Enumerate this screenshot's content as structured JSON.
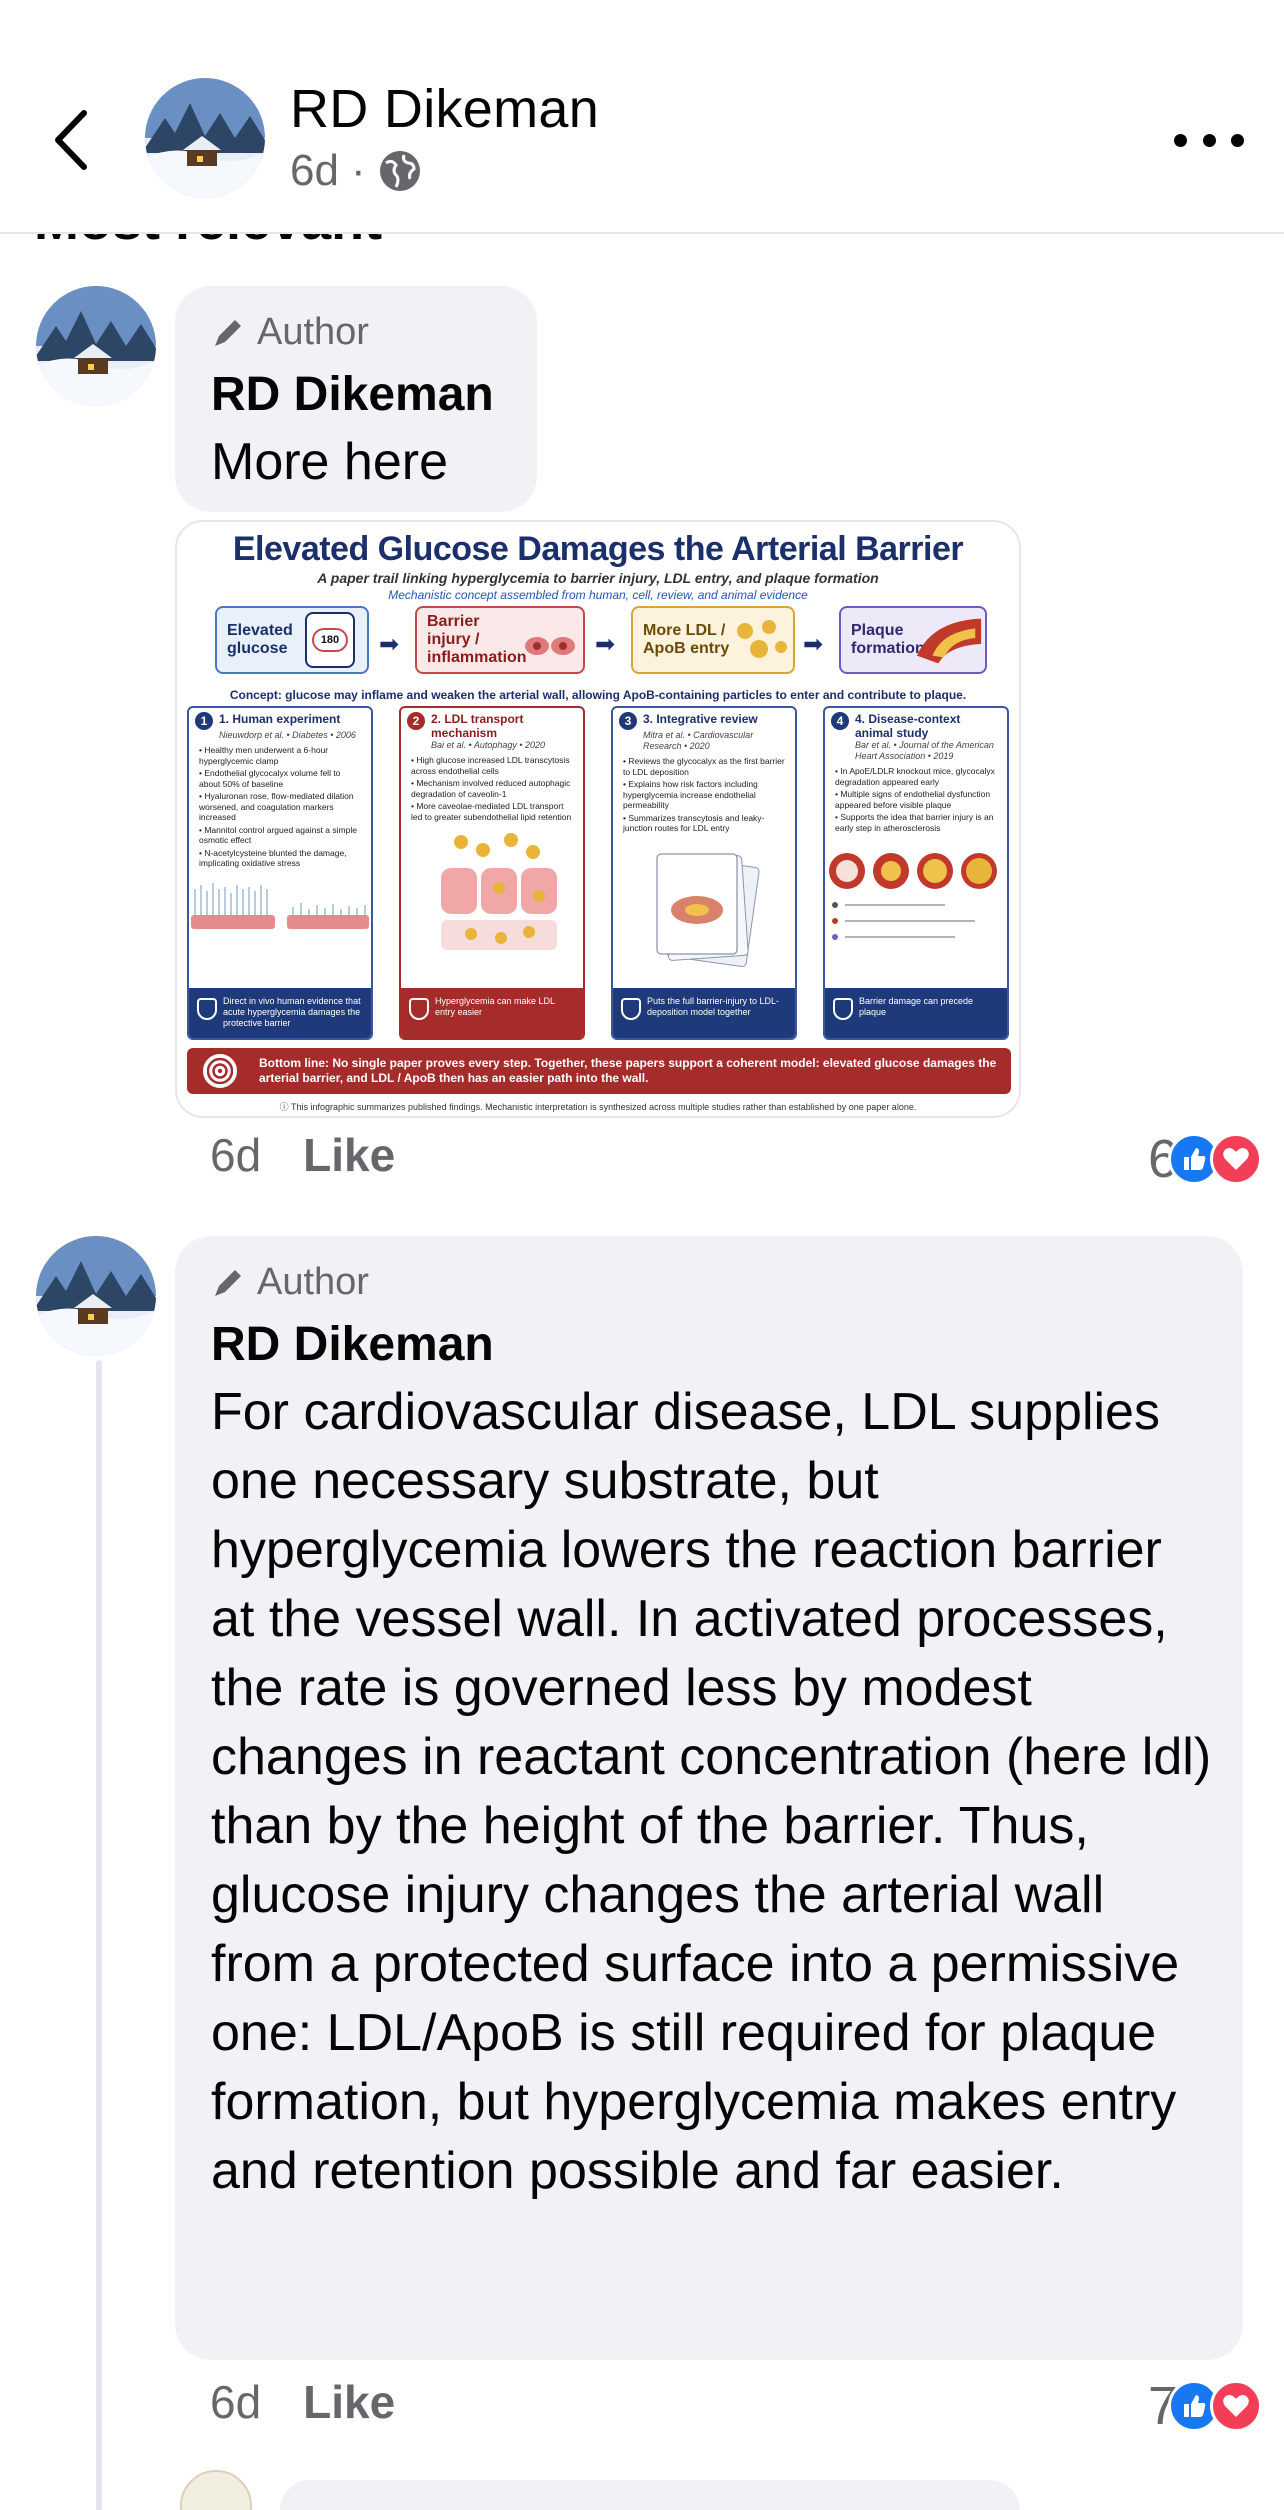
{
  "header": {
    "author_name": "RD Dikeman",
    "age": "6d",
    "separator": "·",
    "audience_icon": "globe-icon",
    "back_icon": "chevron-left-icon",
    "more_icon": "more-horizontal-icon"
  },
  "sort_label": "Most relevant",
  "comments": [
    {
      "badge": "Author",
      "name": "RD Dikeman",
      "text": "More here",
      "age": "6d",
      "like_label": "Like",
      "reaction_count": "6",
      "reactions": [
        "like-reaction-icon",
        "love-reaction-icon"
      ]
    },
    {
      "badge": "Author",
      "name": "RD Dikeman",
      "text": "For cardiovascular disease, LDL supplies one necessary substrate, but hyperglycemia  lowers the reaction barrier at the vessel wall. In activated processes, the rate is governed less by modest changes in reactant concentration (here ldl) than by the height of the barrier. Thus, glucose injury changes the arterial wall from a protected surface into a permissive one: LDL/ApoB is still required for plaque formation, but hyperglycemia makes entry and retention possible and far easier.",
      "age": "6d",
      "like_label": "Like",
      "reaction_count": "7",
      "reactions": [
        "like-reaction-icon",
        "love-reaction-icon"
      ]
    }
  ],
  "infographic": {
    "title": "Elevated Glucose Damages the Arterial Barrier",
    "subtitle": "A paper trail linking hyperglycemia to barrier injury, LDL entry, and plaque formation",
    "subtitle2": "Mechanistic concept assembled from human, cell, review, and animal evidence",
    "flow": [
      "Elevated glucose",
      "Barrier injury / inflammation",
      "More LDL / ApoB entry",
      "Plaque formation"
    ],
    "meter_value": "180",
    "concept": "Concept: glucose may inflame and weaken the arterial wall, allowing ApoB-containing particles to enter and contribute to plaque.",
    "panels": [
      {
        "num": "1",
        "title": "1. Human experiment",
        "cite": "Nieuwdorp et al. • Diabetes • 2006",
        "bullets": [
          "• Healthy men underwent a 6-hour hyperglycemic clamp",
          "• Endothelial glycocalyx volume fell to about 50% of baseline",
          "• Hyaluronan rose, flow-mediated dilation worsened, and coagulation markers increased",
          "• Mannitol control argued against a simple osmotic effect",
          "• N-acetylcysteine blunted the damage, implicating oxidative stress"
        ],
        "footer": "Direct in vivo human evidence that acute hyperglycemia damages the protective barrier"
      },
      {
        "num": "2",
        "title": "2. LDL transport mechanism",
        "cite": "Bai et al. • Autophagy • 2020",
        "bullets": [
          "• High glucose increased LDL transcytosis across endothelial cells",
          "• Mechanism involved reduced autophagic degradation of caveolin-1",
          "• More caveolae-mediated LDL transport led to greater subendothelial lipid retention"
        ],
        "footer": "Hyperglycemia can make LDL entry easier"
      },
      {
        "num": "3",
        "title": "3. Integrative review",
        "cite": "Mitra et al. • Cardiovascular Research • 2020",
        "bullets": [
          "• Reviews the glycocalyx as the first barrier to LDL deposition",
          "• Explains how risk factors including hyperglycemia increase endothelial permeability",
          "• Summarizes transcytosis and leaky-junction routes for LDL entry"
        ],
        "footer": "Puts the full barrier-injury to LDL-deposition model together"
      },
      {
        "num": "4",
        "title": "4. Disease-context animal study",
        "cite": "Bar et al. • Journal of the American Heart Association • 2019",
        "bullets": [
          "• In ApoE/LDLR knockout mice, glycocalyx degradation appeared early",
          "• Multiple signs of endothelial dysfunction appeared before visible plaque",
          "• Supports the idea that barrier injury is an early step in atherosclerosis"
        ],
        "footer": "Barrier damage can precede plaque"
      }
    ],
    "bottom_line": "Bottom line: No single paper proves every step. Together, these papers support a coherent model: elevated glucose damages the arterial barrier, and LDL / ApoB then has an easier path into the wall.",
    "note": "This infographic summarizes published findings. Mechanistic interpretation is synthesized across multiple studies rather than established by one paper alone."
  },
  "colors": {
    "bubble_bg": "#f0f2f5",
    "secondary_text": "#65676b",
    "like_blue": "#1877f2",
    "love_red": "#f33e58",
    "infographic_navy": "#1b2f6b"
  }
}
